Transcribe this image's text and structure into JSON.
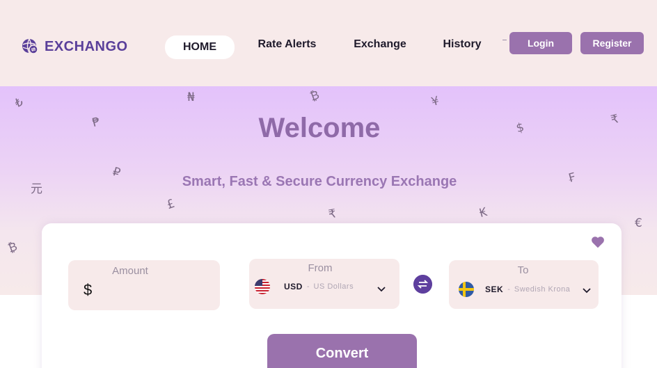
{
  "brand": {
    "name": "EXCHANGO",
    "logo_icon": "globe-exchange-icon",
    "color": "#5a3f9a"
  },
  "nav": {
    "home": "HOME",
    "rate_alerts": "Rate Alerts",
    "exchange": "Exchange",
    "history": "History"
  },
  "auth": {
    "login": "Login",
    "register": "Register"
  },
  "hero": {
    "title": "Welcome",
    "subtitle": "Smart, Fast & Secure Currency Exchange",
    "symbols": [
      "₺",
      "₦",
      "₿",
      "¥",
      "₱",
      "$",
      "₹",
      "₽",
      "元",
      "₣",
      "£",
      "₹",
      "₭",
      "€",
      "₿"
    ]
  },
  "converter": {
    "amount_label": "Amount",
    "amount_prefix": "$",
    "amount_value": "",
    "from_label": "From",
    "from_code": "USD",
    "from_name": "US Dollars",
    "from_flag": "us-flag-icon",
    "to_label": "To",
    "to_code": "SEK",
    "to_name": "Swedish Krona",
    "to_flag": "sweden-flag-icon",
    "swap_icon": "swap-arrows-icon",
    "favorite_icon": "heart-icon",
    "convert_label": "Convert"
  },
  "colors": {
    "accent": "#9a72ad",
    "brand_dark": "#5e3f9e",
    "bg_soft": "#f7eaea"
  }
}
